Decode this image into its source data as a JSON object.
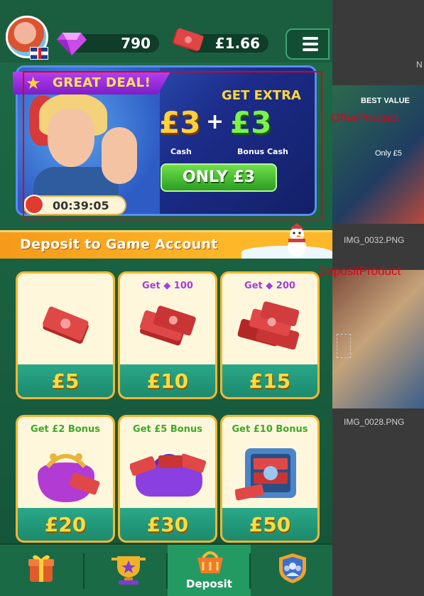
{
  "top_bar": {
    "gems": "790",
    "cash": "£1.66",
    "menu_icon": "hamburger-menu-icon",
    "avatar_icon": "player-avatar",
    "flag_icon": "uk-flag-icon"
  },
  "offer": {
    "badge": "GREAT DEAL!",
    "headline": "GET EXTRA",
    "cash_amount": "£3",
    "plus": "+",
    "bonus_amount": "£3",
    "cash_caption": "Cash",
    "bonus_caption": "Bonus Cash",
    "button_label": "ONLY £3",
    "timer": "00:39:05"
  },
  "deposit_section": {
    "title": "Deposit to Game Account"
  },
  "products": [
    {
      "promo": "",
      "price": "£5"
    },
    {
      "promo": "Get ◆ 100",
      "price": "£10"
    },
    {
      "promo": "Get ◆ 200",
      "price": "£15"
    },
    {
      "promo": "Get £2 Bonus",
      "price": "£20"
    },
    {
      "promo": "Get £5 Bonus",
      "price": "£30"
    },
    {
      "promo": "Get £10 Bonus",
      "price": "£50"
    }
  ],
  "bottom_nav": {
    "items": [
      {
        "icon": "gift-icon",
        "label": ""
      },
      {
        "icon": "trophy-icon",
        "label": ""
      },
      {
        "icon": "deposit-basket-icon",
        "label": "Deposit"
      },
      {
        "icon": "team-shield-icon",
        "label": ""
      }
    ]
  },
  "annotations": {
    "offer_label": "OfferProduct",
    "deposit_label": "DepositProduct"
  },
  "background_files": {
    "file_1": "IMG_0032.PNG",
    "file_2": "IMG_0028.PNG",
    "badge_text": "BEST VALUE",
    "only_text": "Only £5",
    "partial_letter": "N"
  },
  "colors": {
    "game_green": "#1e6b47",
    "accent_orange": "#f59a1a",
    "price_gold": "#ffdb3e",
    "annotation_red": "#e0001a"
  }
}
